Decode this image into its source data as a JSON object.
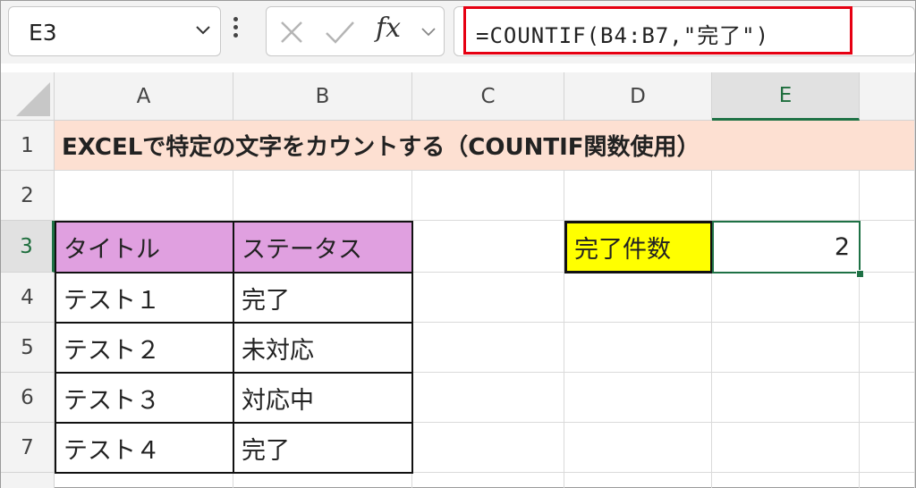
{
  "formula_bar": {
    "name_box": "E3",
    "fx_label": "fx",
    "formula": "=COUNTIF(B4:B7,\"完了\")",
    "cancel_icon": "x-icon",
    "enter_icon": "check-icon"
  },
  "columns": [
    "A",
    "B",
    "C",
    "D",
    "E"
  ],
  "rows": [
    "1",
    "2",
    "3",
    "4",
    "5",
    "6",
    "7"
  ],
  "sheet": {
    "title": "EXCELで特定の文字をカウントする（COUNTIF関数使用）",
    "table": {
      "headers": [
        "タイトル",
        "ステータス"
      ],
      "rows": [
        [
          "テスト１",
          "完了"
        ],
        [
          "テスト２",
          "未対応"
        ],
        [
          "テスト３",
          "対応中"
        ],
        [
          "テスト４",
          "完了"
        ]
      ]
    },
    "count_label": "完了件数",
    "count_value": "2"
  },
  "selection": {
    "column": "E",
    "row": "3"
  },
  "colors": {
    "title_bg": "#fde0d2",
    "header_bg": "#e0a0e0",
    "label_bg": "#ffff00",
    "highlight": "#e60012",
    "selection": "#1e7145"
  }
}
